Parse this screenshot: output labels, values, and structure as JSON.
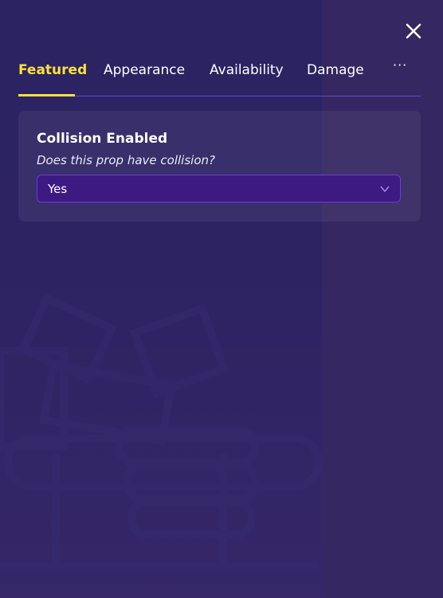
{
  "tabs": [
    {
      "label": "Featured",
      "active": true
    },
    {
      "label": "Appearance",
      "active": false
    },
    {
      "label": "Availability",
      "active": false
    },
    {
      "label": "Damage",
      "active": false
    }
  ],
  "more_label": "···",
  "setting": {
    "title": "Collision Enabled",
    "description": "Does this prop have collision?",
    "selected_value": "Yes"
  },
  "icons": {
    "close": "close-icon",
    "more": "more-horizontal-icon",
    "dropdown": "chevron-down-icon"
  },
  "colors": {
    "accent": "#fde03b",
    "select_bg": "#3d1a82",
    "select_border": "#6b3bdc",
    "tab_divider": "#6a46d6"
  }
}
